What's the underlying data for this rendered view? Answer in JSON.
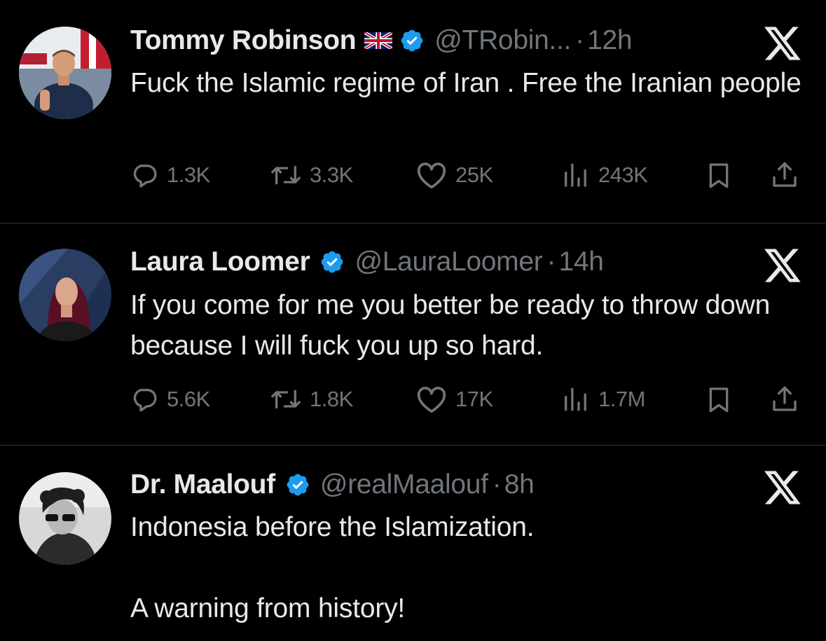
{
  "tweets": [
    {
      "name": "Tommy Robinson",
      "has_flag": true,
      "handle": "@TRobin...",
      "separator": "·",
      "time": "12h",
      "text": "Fuck the Islamic regime of Iran . Free the Iranian people",
      "replies": "1.3K",
      "reposts": "3.3K",
      "likes": "25K",
      "views": "243K"
    },
    {
      "name": "Laura Loomer",
      "has_flag": false,
      "handle": "@LauraLoomer",
      "separator": "·",
      "time": "14h",
      "text": "If you come for me you better be ready to throw down because I will fuck you up so hard.",
      "replies": "5.6K",
      "reposts": "1.8K",
      "likes": "17K",
      "views": "1.7M"
    },
    {
      "name": "Dr. Maalouf",
      "has_flag": false,
      "handle": "@realMaalouf",
      "separator": "·",
      "time": "8h",
      "text": "Indonesia before the Islamization.\n\nA warning from history!"
    }
  ],
  "colors": {
    "background": "#000000",
    "text_primary": "#e7e9ea",
    "text_secondary": "#71767b",
    "verified_blue": "#1d9bf0",
    "divider": "#2f3336"
  },
  "icons": {
    "reply": "reply-bubble-icon",
    "repost": "repost-arrows-icon",
    "like": "heart-icon",
    "views": "analytics-bars-icon",
    "bookmark": "bookmark-icon",
    "share": "share-upload-icon",
    "platform": "x-logo-icon",
    "verified": "verified-badge-icon",
    "flag": "union-jack-flag-icon"
  }
}
